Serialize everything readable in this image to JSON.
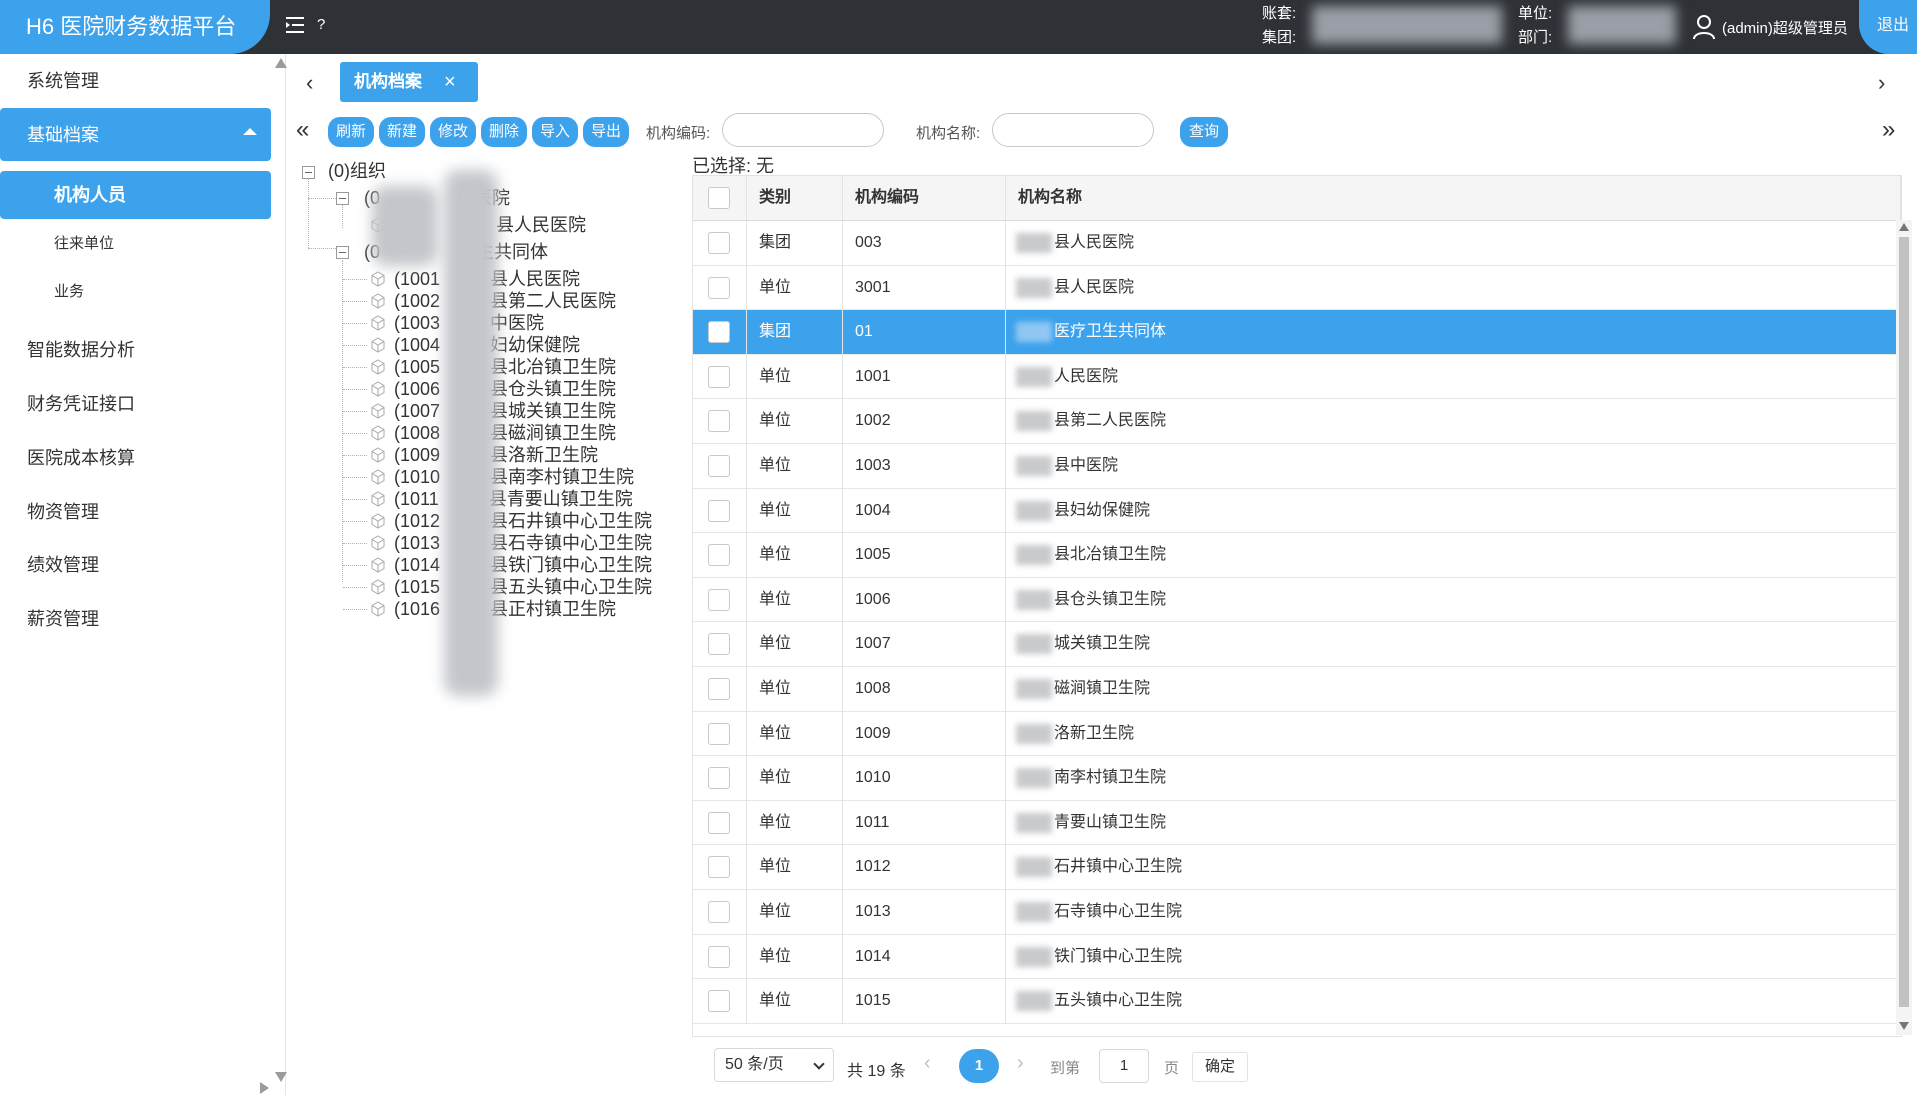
{
  "app": {
    "title": "H6 医院财务数据平台",
    "help": "?",
    "account_label": "账套:",
    "group_label": "集团:",
    "unit_label": "单位:",
    "dept_label": "部门:",
    "user": "(admin)超级管理员",
    "logout": "退出"
  },
  "sidebar": {
    "items": [
      {
        "label": "系统管理"
      },
      {
        "label": "基础档案"
      },
      {
        "label": "机构人员"
      },
      {
        "label": "往来单位"
      },
      {
        "label": "业务"
      },
      {
        "label": "智能数据分析"
      },
      {
        "label": "财务凭证接口"
      },
      {
        "label": "医院成本核算"
      },
      {
        "label": "物资管理"
      },
      {
        "label": "绩效管理"
      },
      {
        "label": "薪资管理"
      }
    ]
  },
  "tabs": [
    {
      "label": "机构档案",
      "close": "×"
    }
  ],
  "toolbar": {
    "refresh": "刷新",
    "new": "新建",
    "edit": "修改",
    "delete": "删除",
    "import": "导入",
    "export": "导出",
    "code_label": "机构编码:",
    "name_label": "机构名称:",
    "query": "查询"
  },
  "tree": {
    "root": "(0)组织",
    "nodes": [
      "(0",
      "民医院",
      "县人民医院",
      "(0",
      "卫生共同体",
      "(1001",
      "县人民医院",
      "(1002",
      "县第二人民医院",
      "(1003",
      "中医院",
      "(1004",
      "妇幼保健院",
      "(1005",
      "县北冶镇卫生院",
      "(1006",
      "县仓头镇卫生院",
      "(1007",
      "县城关镇卫生院",
      "(1008",
      "县磁涧镇卫生院",
      "(1009",
      "县洛新卫生院",
      "(1010",
      "县南李村镇卫生院",
      "(1011",
      "县青要山镇卫生院",
      "(1012",
      "县石井镇中心卫生院",
      "(1013",
      "县石寺镇中心卫生院",
      "(1014",
      "县铁门镇中心卫生院",
      "(1015",
      "县五头镇中心卫生院",
      "(1016",
      "县正村镇卫生院"
    ]
  },
  "grid": {
    "selected_label": "已选择: 无",
    "headers": [
      "类别",
      "机构编码",
      "机构名称"
    ],
    "rows": [
      {
        "type": "集团",
        "code": "003",
        "name": "县人民医院"
      },
      {
        "type": "单位",
        "code": "3001",
        "name": "县人民医院"
      },
      {
        "type": "集团",
        "code": "01",
        "name": "医疗卫生共同体"
      },
      {
        "type": "单位",
        "code": "1001",
        "name": "人民医院"
      },
      {
        "type": "单位",
        "code": "1002",
        "name": "县第二人民医院"
      },
      {
        "type": "单位",
        "code": "1003",
        "name": "县中医院"
      },
      {
        "type": "单位",
        "code": "1004",
        "name": "县妇幼保健院"
      },
      {
        "type": "单位",
        "code": "1005",
        "name": "县北冶镇卫生院"
      },
      {
        "type": "单位",
        "code": "1006",
        "name": "县仓头镇卫生院"
      },
      {
        "type": "单位",
        "code": "1007",
        "name": "城关镇卫生院"
      },
      {
        "type": "单位",
        "code": "1008",
        "name": "磁涧镇卫生院"
      },
      {
        "type": "单位",
        "code": "1009",
        "name": "洛新卫生院"
      },
      {
        "type": "单位",
        "code": "1010",
        "name": "南李村镇卫生院"
      },
      {
        "type": "单位",
        "code": "1011",
        "name": "青要山镇卫生院"
      },
      {
        "type": "单位",
        "code": "1012",
        "name": "石井镇中心卫生院"
      },
      {
        "type": "单位",
        "code": "1013",
        "name": "石寺镇中心卫生院"
      },
      {
        "type": "单位",
        "code": "1014",
        "name": "铁门镇中心卫生院"
      },
      {
        "type": "单位",
        "code": "1015",
        "name": "五头镇中心卫生院"
      }
    ]
  },
  "pager": {
    "page_size": "50 条/页",
    "total": "共 19 条",
    "current": "1",
    "goto": "到第",
    "goto_value": "1",
    "page": "页",
    "ok": "确定"
  },
  "colors": {
    "accent": "#3da2ec",
    "topbar": "#2e3136"
  }
}
